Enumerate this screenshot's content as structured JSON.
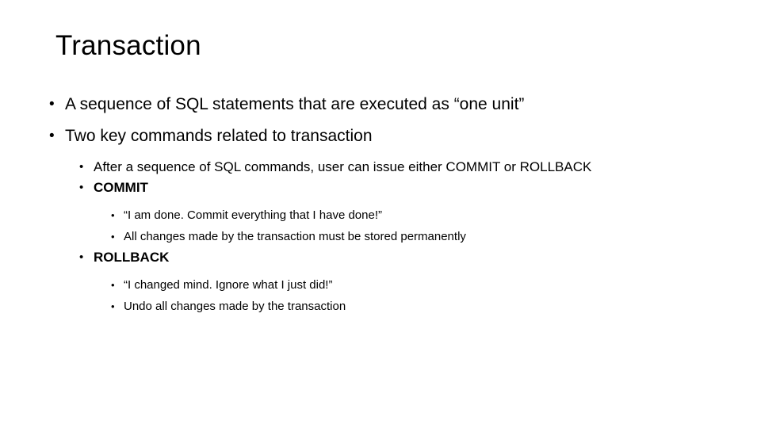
{
  "slide": {
    "title": "Transaction",
    "bullet_glyph": "•",
    "background_color": "#ffffff",
    "text_color": "#000000",
    "content": [
      {
        "level": 1,
        "text": "A sequence of SQL statements that are executed as “one unit”",
        "bold": false
      },
      {
        "level": 1,
        "text": "Two key commands related to transaction",
        "bold": false
      },
      {
        "level": 2,
        "text": "After a sequence of SQL commands, user can issue either COMMIT or ROLLBACK",
        "bold": false
      },
      {
        "level": 2,
        "text": "COMMIT",
        "bold": true
      },
      {
        "level": 3,
        "text": "“I am done. Commit everything that I have done!”",
        "bold": false
      },
      {
        "level": 3,
        "text": "All changes made by the transaction must be stored permanently",
        "bold": false
      },
      {
        "level": 2,
        "text": "ROLLBACK",
        "bold": true
      },
      {
        "level": 3,
        "text": "“I changed mind. Ignore what I just did!”",
        "bold": false
      },
      {
        "level": 3,
        "text": "Undo all changes made by the transaction",
        "bold": false
      }
    ]
  }
}
